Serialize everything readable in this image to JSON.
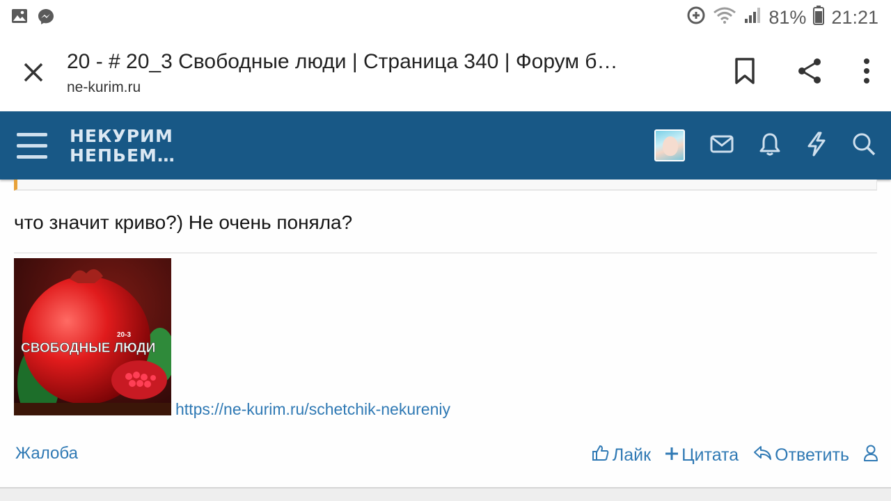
{
  "status_bar": {
    "battery": "81%",
    "time": "21:21",
    "left_icons": [
      "gallery-icon",
      "messenger-icon"
    ],
    "right_icons": [
      "data-saver-icon",
      "wifi-icon",
      "signal-icon",
      "battery-icon"
    ]
  },
  "tab_header": {
    "title": "20 - # 20_3 Свободные люди | Страница 340 | Форум б…",
    "url": "ne-kurim.ru"
  },
  "site_nav": {
    "logo_line1": "НЕКУРИМ",
    "logo_line2": "НЕПЬЕМ…"
  },
  "post": {
    "text": "что значит криво?) Не очень поняла?",
    "signature_image": {
      "small_label": "20-3",
      "caption": "СВОБОДНЫЕ ЛЮДИ"
    },
    "signature_link": "https://ne-kurim.ru/schetchik-nekureniy"
  },
  "actions": {
    "report": "Жалоба",
    "like": "Лайк",
    "quote": "Цитата",
    "reply": "Ответить"
  },
  "colors": {
    "nav_bg": "#185886",
    "link": "#2f79b4",
    "quote_accent": "#e8a23a"
  }
}
